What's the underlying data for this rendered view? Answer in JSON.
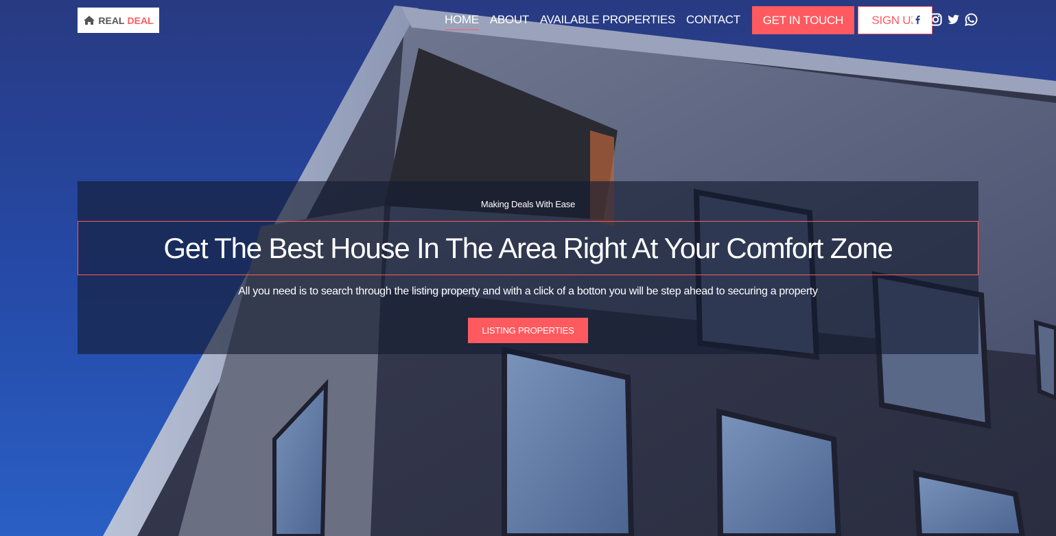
{
  "brand": {
    "word": "REAL",
    "accent": "DEAL",
    "icon": "home-icon"
  },
  "nav": {
    "items": [
      {
        "label": "HOME",
        "active": true
      },
      {
        "label": "ABOUT",
        "active": false
      },
      {
        "label": "AVAILABLE PROPERTIES",
        "active": false
      },
      {
        "label": "CONTACT",
        "active": false
      }
    ],
    "cta_primary": "GET IN TOUCH",
    "cta_secondary": "SIGN UP"
  },
  "socials": [
    "facebook-icon",
    "instagram-icon",
    "twitter-icon",
    "whatsapp-icon"
  ],
  "hero": {
    "kicker": "Making Deals With Ease",
    "title": "Get The Best House In The Area Right At Your Comfort Zone",
    "description": "All you need is to search through the listing property and with a click of a botton you will be step ahead to securing a property",
    "button": "LISTING PROPERTIES"
  },
  "colors": {
    "accent": "#ff5a5f",
    "sky": "#2a55b0",
    "overlay": "#141c30"
  }
}
